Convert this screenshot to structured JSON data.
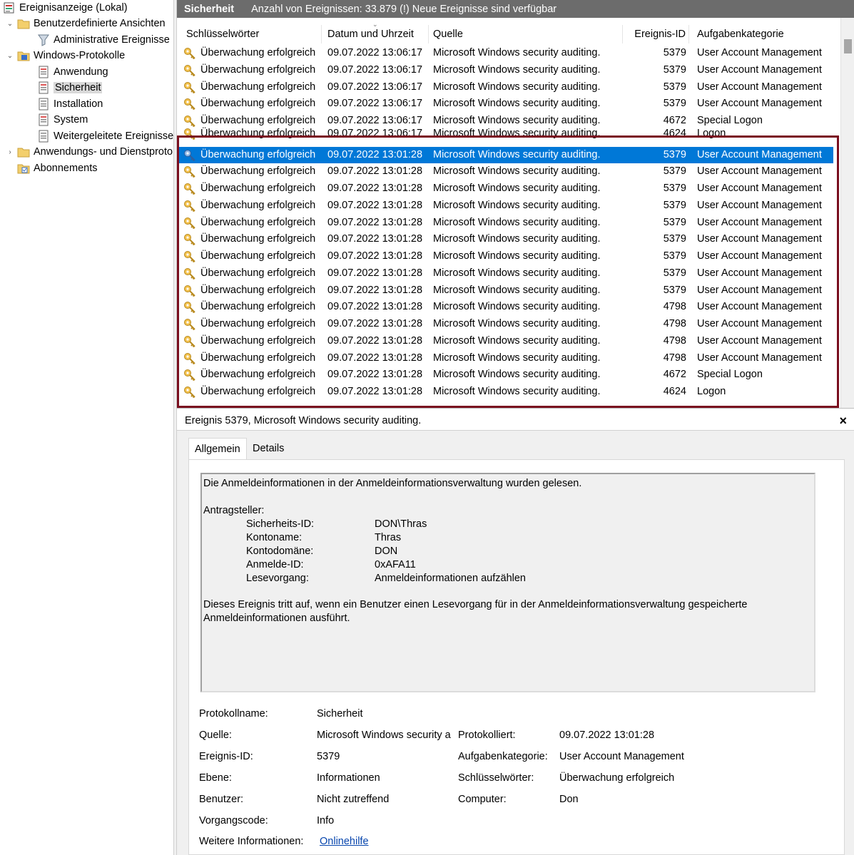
{
  "tree": {
    "root": "Ereignisanzeige (Lokal)",
    "custom_views": "Benutzerdefinierte Ansichten",
    "admin_events": "Administrative Ereignisse",
    "windows_logs": "Windows-Protokolle",
    "logs": [
      "Anwendung",
      "Sicherheit",
      "Installation",
      "System",
      "Weitergeleitete Ereignisse"
    ],
    "app_services": "Anwendungs- und Dienstprotokolle",
    "subscriptions": "Abonnements"
  },
  "header": {
    "title": "Sicherheit",
    "status": "Anzahl von Ereignissen: 33.879 (!) Neue Ereignisse sind verfügbar"
  },
  "columns": [
    "Schlüsselwörter",
    "Datum und Uhrzeit",
    "Quelle",
    "Ereignis-ID",
    "Aufgabenkategorie"
  ],
  "events": [
    {
      "kw": "Überwachung erfolgreich",
      "dt": "09.07.2022 13:06:17",
      "src": "Microsoft Windows security auditing.",
      "eid": "5379",
      "cat": "User Account Management"
    },
    {
      "kw": "Überwachung erfolgreich",
      "dt": "09.07.2022 13:06:17",
      "src": "Microsoft Windows security auditing.",
      "eid": "5379",
      "cat": "User Account Management"
    },
    {
      "kw": "Überwachung erfolgreich",
      "dt": "09.07.2022 13:06:17",
      "src": "Microsoft Windows security auditing.",
      "eid": "5379",
      "cat": "User Account Management"
    },
    {
      "kw": "Überwachung erfolgreich",
      "dt": "09.07.2022 13:06:17",
      "src": "Microsoft Windows security auditing.",
      "eid": "5379",
      "cat": "User Account Management"
    },
    {
      "kw": "Überwachung erfolgreich",
      "dt": "09.07.2022 13:06:17",
      "src": "Microsoft Windows security auditing.",
      "eid": "4672",
      "cat": "Special Logon"
    },
    {
      "kw": "Überwachung erfolgreich",
      "dt": "09.07.2022 13:06:17",
      "src": "Microsoft Windows security auditing.",
      "eid": "4624",
      "cat": "Logon"
    },
    {
      "kw": "Überwachung erfolgreich",
      "dt": "09.07.2022 13:01:28",
      "src": "Microsoft Windows security auditing.",
      "eid": "5379",
      "cat": "User Account Management",
      "selected": true
    },
    {
      "kw": "Überwachung erfolgreich",
      "dt": "09.07.2022 13:01:28",
      "src": "Microsoft Windows security auditing.",
      "eid": "5379",
      "cat": "User Account Management"
    },
    {
      "kw": "Überwachung erfolgreich",
      "dt": "09.07.2022 13:01:28",
      "src": "Microsoft Windows security auditing.",
      "eid": "5379",
      "cat": "User Account Management"
    },
    {
      "kw": "Überwachung erfolgreich",
      "dt": "09.07.2022 13:01:28",
      "src": "Microsoft Windows security auditing.",
      "eid": "5379",
      "cat": "User Account Management"
    },
    {
      "kw": "Überwachung erfolgreich",
      "dt": "09.07.2022 13:01:28",
      "src": "Microsoft Windows security auditing.",
      "eid": "5379",
      "cat": "User Account Management"
    },
    {
      "kw": "Überwachung erfolgreich",
      "dt": "09.07.2022 13:01:28",
      "src": "Microsoft Windows security auditing.",
      "eid": "5379",
      "cat": "User Account Management"
    },
    {
      "kw": "Überwachung erfolgreich",
      "dt": "09.07.2022 13:01:28",
      "src": "Microsoft Windows security auditing.",
      "eid": "5379",
      "cat": "User Account Management"
    },
    {
      "kw": "Überwachung erfolgreich",
      "dt": "09.07.2022 13:01:28",
      "src": "Microsoft Windows security auditing.",
      "eid": "5379",
      "cat": "User Account Management"
    },
    {
      "kw": "Überwachung erfolgreich",
      "dt": "09.07.2022 13:01:28",
      "src": "Microsoft Windows security auditing.",
      "eid": "5379",
      "cat": "User Account Management"
    },
    {
      "kw": "Überwachung erfolgreich",
      "dt": "09.07.2022 13:01:28",
      "src": "Microsoft Windows security auditing.",
      "eid": "4798",
      "cat": "User Account Management"
    },
    {
      "kw": "Überwachung erfolgreich",
      "dt": "09.07.2022 13:01:28",
      "src": "Microsoft Windows security auditing.",
      "eid": "4798",
      "cat": "User Account Management"
    },
    {
      "kw": "Überwachung erfolgreich",
      "dt": "09.07.2022 13:01:28",
      "src": "Microsoft Windows security auditing.",
      "eid": "4798",
      "cat": "User Account Management"
    },
    {
      "kw": "Überwachung erfolgreich",
      "dt": "09.07.2022 13:01:28",
      "src": "Microsoft Windows security auditing.",
      "eid": "4798",
      "cat": "User Account Management"
    },
    {
      "kw": "Überwachung erfolgreich",
      "dt": "09.07.2022 13:01:28",
      "src": "Microsoft Windows security auditing.",
      "eid": "4672",
      "cat": "Special Logon"
    },
    {
      "kw": "Überwachung erfolgreich",
      "dt": "09.07.2022 13:01:28",
      "src": "Microsoft Windows security auditing.",
      "eid": "4624",
      "cat": "Logon"
    }
  ],
  "detail": {
    "title": "Ereignis 5379, Microsoft Windows security auditing.",
    "close": "×",
    "tabs": [
      "Allgemein",
      "Details"
    ],
    "message": {
      "intro": "Die Anmeldeinformationen in der Anmeldeinformationsverwaltung wurden gelesen.",
      "section": "Antragsteller:",
      "fields": [
        {
          "label": "Sicherheits-ID:",
          "value": "DON\\Thras"
        },
        {
          "label": "Kontoname:",
          "value": "Thras"
        },
        {
          "label": "Kontodomäne:",
          "value": "DON"
        },
        {
          "label": "Anmelde-ID:",
          "value": "0xAFA11"
        },
        {
          "label": "Lesevorgang:",
          "value": "Anmeldeinformationen aufzählen"
        }
      ],
      "explain_1": "Dieses Ereignis tritt auf, wenn ein Benutzer einen Lesevorgang für in der Anmeldeinformationsverwaltung gespeicherte",
      "explain_2": "Anmeldeinformationen ausführt."
    },
    "props": {
      "log_name_label": "Protokollname:",
      "log_name": "Sicherheit",
      "source_label": "Quelle:",
      "source": "Microsoft Windows security a",
      "logged_label": "Protokolliert:",
      "logged": "09.07.2022 13:01:28",
      "event_id_label": "Ereignis-ID:",
      "event_id": "5379",
      "task_cat_label": "Aufgabenkategorie:",
      "task_cat": "User Account Management",
      "level_label": "Ebene:",
      "level": "Informationen",
      "keywords_label": "Schlüsselwörter:",
      "keywords": "Überwachung erfolgreich",
      "user_label": "Benutzer:",
      "user": "Nicht zutreffend",
      "computer_label": "Computer:",
      "computer": "Don",
      "opcode_label": "Vorgangscode:",
      "opcode": "Info",
      "more_info_label": "Weitere Informationen:",
      "more_info": "Onlinehilfe"
    }
  }
}
